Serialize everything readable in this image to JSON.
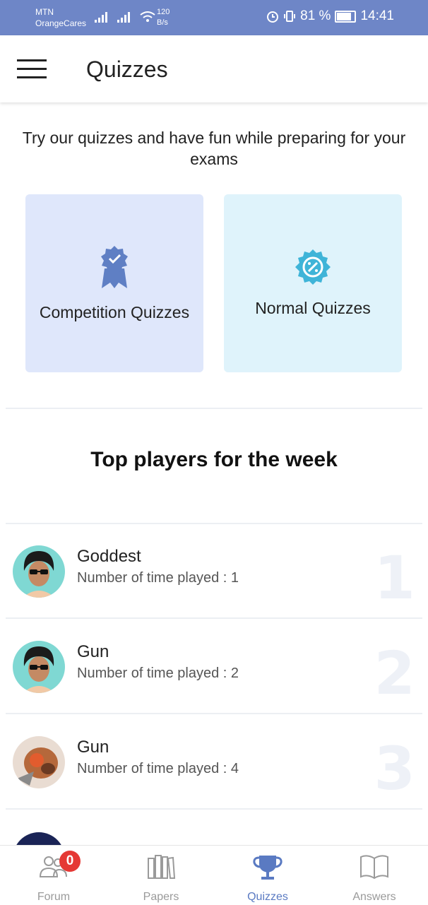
{
  "status_bar": {
    "carrier1": "MTN",
    "carrier2": "OrangeCares",
    "speed": "120",
    "speed_unit": "B/s",
    "battery": "81 %",
    "time": "14:41"
  },
  "app_bar": {
    "title": "Quizzes",
    "menu_icon": "hamburger-icon"
  },
  "intro_text": "Try our quizzes and have fun while preparing for your exams",
  "cards": [
    {
      "label": "Competition Quizzes",
      "icon": "award-ribbon-icon",
      "color": "#dfe7fb"
    },
    {
      "label": "Normal  Quizzes",
      "icon": "percent-badge-icon",
      "color": "#dff3fb"
    }
  ],
  "top_players": {
    "title": "Top players for the week",
    "players": [
      {
        "name": "Goddest",
        "count_text": "Number of time played : 1",
        "rank": "1"
      },
      {
        "name": "Gun",
        "count_text": "Number of time played : 2",
        "rank": "2"
      },
      {
        "name": "Gun",
        "count_text": "Number of time played : 4",
        "rank": "3"
      }
    ]
  },
  "bottom_nav": {
    "items": [
      {
        "label": "Forum",
        "icon": "people-icon",
        "badge": "0"
      },
      {
        "label": "Papers",
        "icon": "books-icon"
      },
      {
        "label": "Quizzes",
        "icon": "trophy-icon",
        "active": true
      },
      {
        "label": "Answers",
        "icon": "open-book-icon"
      }
    ]
  },
  "colors": {
    "status_bar": "#6e86c7",
    "accent": "#5a7ac2",
    "badge": "#e53935",
    "card_icon": "#5f7fc4",
    "card_icon_blue": "#3fb4d8"
  }
}
